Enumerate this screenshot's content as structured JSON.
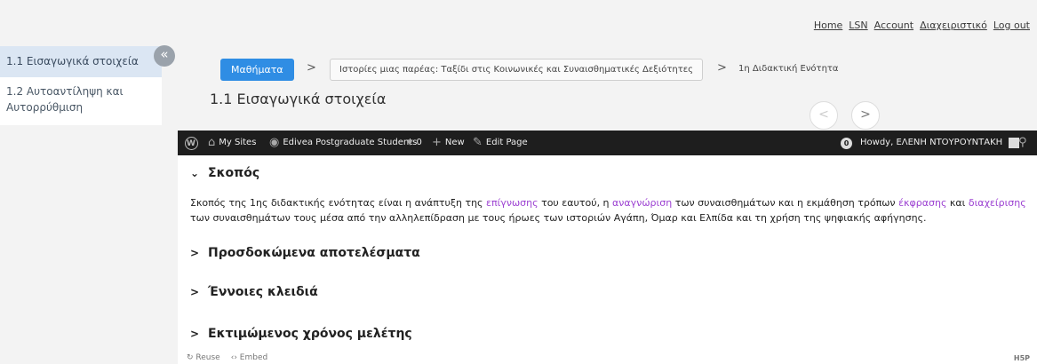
{
  "topnav": [
    "Home",
    "LSN",
    "Account",
    "Διαχειριστικό",
    "Log out"
  ],
  "sidebar": {
    "items": [
      {
        "label": "1.1 Εισαγωγικά στοιχεία"
      },
      {
        "label": "1.2 Αυτοαντίληψη και Αυτορρύθμιση"
      }
    ],
    "collapse_glyph": "«"
  },
  "breadcrumb": {
    "home": "Μαθήματα",
    "separator": ">",
    "course": "Ιστορίες μιας παρέας: Ταξίδι στις Κοινωνικές και Συναισθηματικές Δεξιότητες",
    "unit": "1η Διδακτική Ενότητα"
  },
  "page_title": "1.1 Εισαγωγικά στοιχεία",
  "nav": {
    "prev": "<",
    "next": ">"
  },
  "wpbar": {
    "my_sites": "My Sites",
    "site": "Edivea Postgraduate Students",
    "comments": "0",
    "new": "New",
    "edit": "Edit Page",
    "notif": "0",
    "howdy": "Howdy, ΕΛΕΝΗ ΝΤΟΥΡΟΥΝΤΑΚΗ"
  },
  "accordion": [
    {
      "title": "Σκοπός",
      "chevron": "⌄",
      "expanded": true
    },
    {
      "title": "Προσδοκώμενα αποτελέσματα",
      "chevron": ">"
    },
    {
      "title": "Έννοιες κλειδιά",
      "chevron": ">"
    },
    {
      "title": "Εκτιμώμενος χρόνος μελέτης",
      "chevron": ">"
    }
  ],
  "body": {
    "t1": "Σκοπός της 1ης διδακτικής ενότητας είναι η ανάπτυξη της ",
    "l1": "επίγνωσης",
    "t2": " του εαυτού, η ",
    "l2": "αναγνώριση",
    "t3": " των συναισθημάτων και η εκμάθηση τρόπων ",
    "l3": "έκφρασης",
    "t4": " και ",
    "l4": "διαχείρισης",
    "t5": " των συναισθημάτων τους μέσα από την αλληλεπίδραση με τους ήρωες των ιστοριών Αγάπη, Όμαρ και Ελπίδα και τη χρήση της ψηφιακής αφήγησης."
  },
  "footer": {
    "reuse": "Reuse",
    "embed": "Embed",
    "h5p": "H5P"
  },
  "colors": {
    "accent": "#2f8de4",
    "link": "#9b3fd1",
    "wpbar": "#1e1e1e",
    "active_side": "#dbe6f3"
  }
}
